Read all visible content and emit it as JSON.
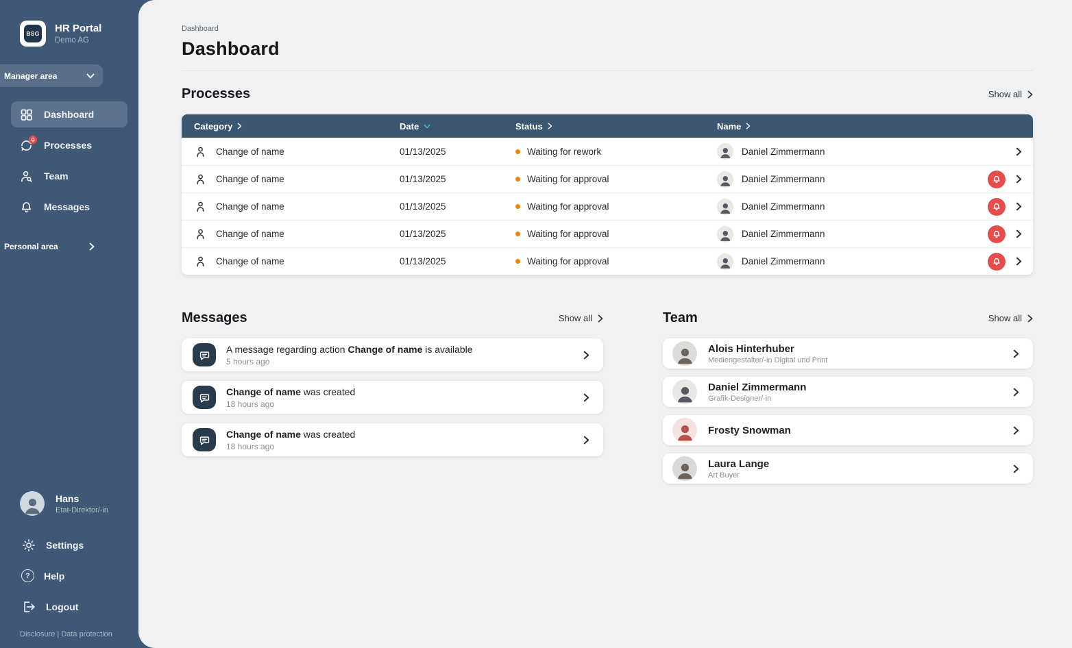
{
  "app": {
    "logo_text": "BSG",
    "name": "HR Portal",
    "org": "Demo AG"
  },
  "icons": {
    "help_glyph": "?"
  },
  "sidebar": {
    "area_switcher_label": "Manager area",
    "nav": [
      {
        "label": "Dashboard",
        "icon": "grid-icon",
        "active": true
      },
      {
        "label": "Processes",
        "icon": "sync-icon",
        "has_alert": true
      },
      {
        "label": "Team",
        "icon": "team-icon"
      },
      {
        "label": "Messages",
        "icon": "bell-icon"
      }
    ],
    "personal_area_label": "Personal area",
    "user": {
      "name": "Hans",
      "role": "Etat-Direktor/-in",
      "avatar": {
        "bg": "#cfd9e0",
        "fg": "#5d6f7d"
      }
    },
    "footer_nav": [
      {
        "label": "Settings",
        "icon": "gear-icon"
      },
      {
        "label": "Help",
        "icon": "help-icon"
      },
      {
        "label": "Logout",
        "icon": "logout-icon"
      }
    ],
    "legal": "Disclosure | Data protection"
  },
  "header": {
    "breadcrumb": "Dashboard",
    "title": "Dashboard"
  },
  "processes": {
    "heading": "Processes",
    "show_all_label": "Show all",
    "columns": {
      "category": "Category",
      "date": "Date",
      "status": "Status",
      "name": "Name"
    },
    "sorted_column": "Date",
    "rows": [
      {
        "category": "Change of name",
        "date": "01/13/2025",
        "status": "Waiting for rework",
        "name": "Daniel Zimmermann",
        "has_alert": false,
        "avatar": {
          "bg": "#e9e7e3",
          "fg": "#565a60"
        }
      },
      {
        "category": "Change of name",
        "date": "01/13/2025",
        "status": "Waiting for approval",
        "name": "Daniel Zimmermann",
        "has_alert": true,
        "avatar": {
          "bg": "#e9e7e3",
          "fg": "#565a60"
        }
      },
      {
        "category": "Change of name",
        "date": "01/13/2025",
        "status": "Waiting for approval",
        "name": "Daniel Zimmermann",
        "has_alert": true,
        "avatar": {
          "bg": "#e9e7e3",
          "fg": "#565a60"
        }
      },
      {
        "category": "Change of name",
        "date": "01/13/2025",
        "status": "Waiting for approval",
        "name": "Daniel Zimmermann",
        "has_alert": true,
        "avatar": {
          "bg": "#e9e7e3",
          "fg": "#565a60"
        }
      },
      {
        "category": "Change of name",
        "date": "01/13/2025",
        "status": "Waiting for approval",
        "name": "Daniel Zimmermann",
        "has_alert": true,
        "avatar": {
          "bg": "#e9e7e3",
          "fg": "#565a60"
        }
      }
    ]
  },
  "messages": {
    "heading": "Messages",
    "show_all_label": "Show all",
    "items": [
      {
        "prefix": "A message regarding action ",
        "bold": "Change of name",
        "suffix": " is available",
        "time": "5 hours ago"
      },
      {
        "prefix": "",
        "bold": "Change of name",
        "suffix": " was created",
        "time": "18 hours ago"
      },
      {
        "prefix": "",
        "bold": "Change of name",
        "suffix": " was created",
        "time": "18 hours ago"
      }
    ]
  },
  "team": {
    "heading": "Team",
    "show_all_label": "Show all",
    "members": [
      {
        "name": "Alois Hinterhuber",
        "role": "Mediengestalter/-in Digital und Print",
        "avatar": {
          "bg": "#dedcd8",
          "fg": "#6b6560"
        }
      },
      {
        "name": "Daniel Zimmermann",
        "role": "Grafik-Designer/-in",
        "avatar": {
          "bg": "#e9e7e3",
          "fg": "#565a60"
        }
      },
      {
        "name": "Frosty Snowman",
        "role": "",
        "avatar": {
          "bg": "#f3e3e0",
          "fg": "#b8504a"
        }
      },
      {
        "name": "Laura Lange",
        "role": "Art Buyer",
        "avatar": {
          "bg": "#d9d9d9",
          "fg": "#6e625c"
        }
      }
    ]
  },
  "colors": {
    "sidebar": "#3e5876",
    "table_header": "#3c5570",
    "accent_teal": "#45bdb0",
    "status_orange": "#e8830b",
    "alert_red": "#e44d4d",
    "content_bg": "#f0f1f3",
    "message_icon_bg": "#2a3b4d"
  }
}
